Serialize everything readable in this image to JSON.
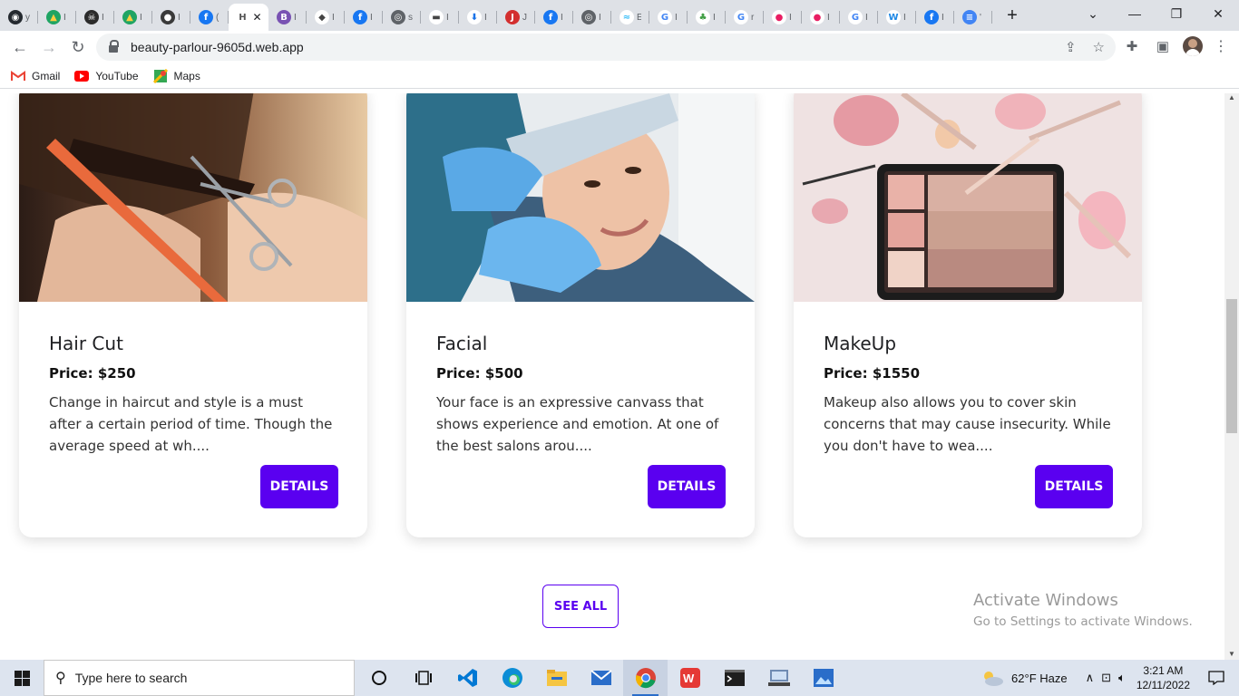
{
  "browser": {
    "tabs": [
      {
        "icon": "github-icon",
        "glyph": "◉",
        "color": "#24292f",
        "fg": "#ffffff",
        "ch": "y"
      },
      {
        "icon": "google-drive-icon",
        "glyph": "▲",
        "color": "#1fa463",
        "fg": "#ffcd40",
        "ch": "I"
      },
      {
        "icon": "pirate-icon",
        "glyph": "☠",
        "color": "#2b2b2b",
        "fg": "#ffffff",
        "ch": "I"
      },
      {
        "icon": "google-drive-icon",
        "glyph": "▲",
        "color": "#1fa463",
        "fg": "#ffcd40",
        "ch": "I"
      },
      {
        "icon": "dark-circle-icon",
        "glyph": "●",
        "color": "#3a3a3a",
        "fg": "#ffffff",
        "ch": "I"
      },
      {
        "icon": "facebook-icon",
        "glyph": "f",
        "color": "#1877f2",
        "fg": "#ffffff",
        "ch": "("
      },
      {
        "icon": "h-favicon-icon",
        "glyph": "H",
        "color": "#ffffff",
        "fg": "#555555",
        "ch": "",
        "active": true
      },
      {
        "icon": "bootstrap-icon",
        "glyph": "B",
        "color": "#7952b3",
        "fg": "#ffffff",
        "ch": "I"
      },
      {
        "icon": "diamond-icon",
        "glyph": "◆",
        "color": "#ffffff",
        "fg": "#444444",
        "ch": "I"
      },
      {
        "icon": "facebook-icon",
        "glyph": "f",
        "color": "#1877f2",
        "fg": "#ffffff",
        "ch": "I"
      },
      {
        "icon": "globe-icon",
        "glyph": "◎",
        "color": "#5f6368",
        "fg": "#ffffff",
        "ch": "s"
      },
      {
        "icon": "graduation-cap-icon",
        "glyph": "▬",
        "color": "#ffffff",
        "fg": "#444444",
        "ch": "I"
      },
      {
        "icon": "download-icon",
        "glyph": "⬇",
        "color": "#ffffff",
        "fg": "#1a73e8",
        "ch": "I"
      },
      {
        "icon": "jpg-png-icon",
        "glyph": "J",
        "color": "#d32f2f",
        "fg": "#ffffff",
        "ch": "J"
      },
      {
        "icon": "facebook-icon",
        "glyph": "f",
        "color": "#1877f2",
        "fg": "#ffffff",
        "ch": "I"
      },
      {
        "icon": "globe-icon",
        "glyph": "◎",
        "color": "#5f6368",
        "fg": "#ffffff",
        "ch": "I"
      },
      {
        "icon": "tailwind-icon",
        "glyph": "≈",
        "color": "#ffffff",
        "fg": "#38bdf8",
        "ch": "E"
      },
      {
        "icon": "google-icon",
        "glyph": "G",
        "color": "#ffffff",
        "fg": "#4285f4",
        "ch": "I"
      },
      {
        "icon": "leaf-icon",
        "glyph": "♣",
        "color": "#ffffff",
        "fg": "#43a047",
        "ch": "I"
      },
      {
        "icon": "google-icon",
        "glyph": "G",
        "color": "#ffffff",
        "fg": "#4285f4",
        "ch": "r"
      },
      {
        "icon": "pink-drop-icon",
        "glyph": "●",
        "color": "#ffffff",
        "fg": "#e91e63",
        "ch": "I"
      },
      {
        "icon": "pink-drop-icon",
        "glyph": "●",
        "color": "#ffffff",
        "fg": "#e91e63",
        "ch": "I"
      },
      {
        "icon": "google-icon",
        "glyph": "G",
        "color": "#ffffff",
        "fg": "#4285f4",
        "ch": "I"
      },
      {
        "icon": "w-logo-icon",
        "glyph": "W",
        "color": "#ffffff",
        "fg": "#1e88e5",
        "ch": "I"
      },
      {
        "icon": "facebook-icon",
        "glyph": "f",
        "color": "#1877f2",
        "fg": "#ffffff",
        "ch": "I"
      },
      {
        "icon": "google-docs-icon",
        "glyph": "≡",
        "color": "#4285f4",
        "fg": "#ffffff",
        "ch": "'"
      }
    ],
    "url": "beauty-parlour-9605d.web.app",
    "bookmarks": [
      {
        "label": "Gmail",
        "icon": "gmail-icon"
      },
      {
        "label": "YouTube",
        "icon": "youtube-icon"
      },
      {
        "label": "Maps",
        "icon": "maps-icon"
      }
    ]
  },
  "services": [
    {
      "title": "Hair Cut",
      "price": "Price: $250",
      "description": "Change in haircut and style is a must after a certain period of time. Though the average speed at wh....",
      "button": "DETAILS",
      "image": "haircut-photo"
    },
    {
      "title": "Facial",
      "price": "Price: $500",
      "description": "Your face is an expressive canvass that shows experience and emotion. At one of the best salons arou....",
      "button": "DETAILS",
      "image": "facial-photo"
    },
    {
      "title": "MakeUp",
      "price": "Price: $1550",
      "description": "Makeup also allows you to cover skin concerns that may cause insecurity. While you don't have to wea....",
      "button": "DETAILS",
      "image": "makeup-photo"
    }
  ],
  "see_all": "SEE ALL",
  "watermark": {
    "title": "Activate Windows",
    "subtitle": "Go to Settings to activate Windows."
  },
  "taskbar": {
    "search_placeholder": "Type here to search",
    "weather": "62°F  Haze",
    "time": "3:21 AM",
    "date": "12/11/2022"
  },
  "colors": {
    "accent": "#5a00f0"
  }
}
